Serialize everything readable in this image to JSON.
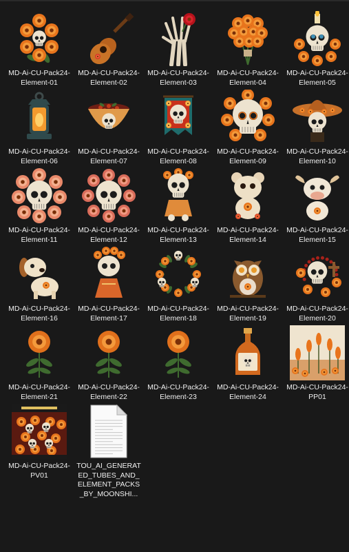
{
  "files": [
    {
      "name": "MD-Ai-CU-Pack24-Element-01",
      "icon": "marigold-skull-wreath-icon"
    },
    {
      "name": "MD-Ai-CU-Pack24-Element-02",
      "icon": "guitar-icon"
    },
    {
      "name": "MD-Ai-CU-Pack24-Element-03",
      "icon": "skeleton-hand-rose-icon"
    },
    {
      "name": "MD-Ai-CU-Pack24-Element-04",
      "icon": "marigold-bouquet-icon"
    },
    {
      "name": "MD-Ai-CU-Pack24-Element-05",
      "icon": "candle-skull-icon"
    },
    {
      "name": "MD-Ai-CU-Pack24-Element-06",
      "icon": "lantern-icon"
    },
    {
      "name": "MD-Ai-CU-Pack24-Element-07",
      "icon": "skull-bowl-icon"
    },
    {
      "name": "MD-Ai-CU-Pack24-Element-08",
      "icon": "skull-banner-icon"
    },
    {
      "name": "MD-Ai-CU-Pack24-Element-09",
      "icon": "sugar-skull-icon"
    },
    {
      "name": "MD-Ai-CU-Pack24-Element-10",
      "icon": "sombrero-skull-icon"
    },
    {
      "name": "MD-Ai-CU-Pack24-Element-11",
      "icon": "flower-skull-icon"
    },
    {
      "name": "MD-Ai-CU-Pack24-Element-12",
      "icon": "rose-skull-wreath-icon"
    },
    {
      "name": "MD-Ai-CU-Pack24-Element-13",
      "icon": "skull-doll-icon"
    },
    {
      "name": "MD-Ai-CU-Pack24-Element-14",
      "icon": "teddy-bear-icon"
    },
    {
      "name": "MD-Ai-CU-Pack24-Element-15",
      "icon": "cow-plush-icon"
    },
    {
      "name": "MD-Ai-CU-Pack24-Element-16",
      "icon": "puppy-icon"
    },
    {
      "name": "MD-Ai-CU-Pack24-Element-17",
      "icon": "catrina-doll-icon"
    },
    {
      "name": "MD-Ai-CU-Pack24-Element-18",
      "icon": "skull-wreath-icon"
    },
    {
      "name": "MD-Ai-CU-Pack24-Element-19",
      "icon": "owl-icon"
    },
    {
      "name": "MD-Ai-CU-Pack24-Element-20",
      "icon": "skull-rosary-icon"
    },
    {
      "name": "MD-Ai-CU-Pack24-Element-21",
      "icon": "marigold-flower-icon"
    },
    {
      "name": "MD-Ai-CU-Pack24-Element-22",
      "icon": "marigold-flower-icon"
    },
    {
      "name": "MD-Ai-CU-Pack24-Element-23",
      "icon": "marigold-flower-icon"
    },
    {
      "name": "MD-Ai-CU-Pack24-Element-24",
      "icon": "tequila-bottle-icon"
    },
    {
      "name": "MD-Ai-CU-Pack24-PP01",
      "icon": "paper-preview-icon"
    },
    {
      "name": "MD-Ai-CU-Pack24-PV01",
      "icon": "pack-preview-icon"
    },
    {
      "name": "TOU_AI_GENERATED_TUBES_AND_ELEMENT_PACKS_BY_MOONSHI...",
      "icon": "text-document-icon"
    }
  ],
  "colors": {
    "background": "#191919",
    "label_text": "#f0f0f0",
    "marigold": "#e8741c",
    "skull": "#ede3cf",
    "leaf": "#3f6b2f"
  }
}
